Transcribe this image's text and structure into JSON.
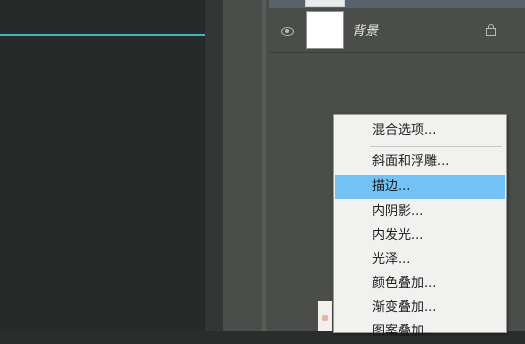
{
  "layers": {
    "background_layer_name": "背景"
  },
  "context_menu": {
    "items": [
      {
        "label": "混合选项...",
        "highlighted": false
      },
      {
        "label": "斜面和浮雕...",
        "highlighted": false
      },
      {
        "label": "描边...",
        "highlighted": true
      },
      {
        "label": "内阴影...",
        "highlighted": false
      },
      {
        "label": "内发光...",
        "highlighted": false
      },
      {
        "label": "光泽...",
        "highlighted": false
      },
      {
        "label": "颜色叠加...",
        "highlighted": false
      },
      {
        "label": "渐变叠加...",
        "highlighted": false
      },
      {
        "label": "图案叠加...",
        "highlighted": false
      }
    ]
  },
  "colors": {
    "highlight": "#73c1f5",
    "guide_line": "#3fb7c6",
    "menu_bg": "#f1f1f0"
  }
}
